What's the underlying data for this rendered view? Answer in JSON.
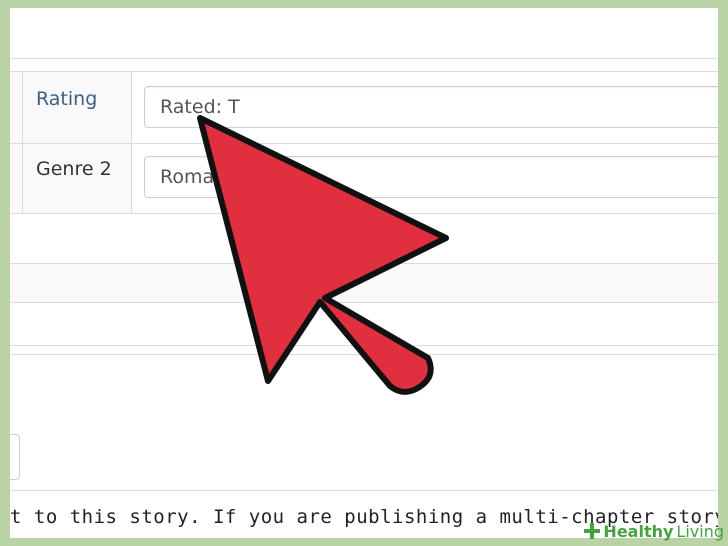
{
  "form": {
    "rows": [
      {
        "label": "Rating",
        "value": "Rated: T"
      },
      {
        "label": "Genre 2",
        "value": "Roma"
      }
    ]
  },
  "footer": {
    "text": "t to this story. If you are publishing a multi-chapter story, please selec"
  },
  "cursor": {
    "fill": "#e0303f",
    "stroke": "#111111"
  },
  "watermark": {
    "part1": "Healthy",
    "part2": "Living",
    "icon": "plus-icon"
  }
}
